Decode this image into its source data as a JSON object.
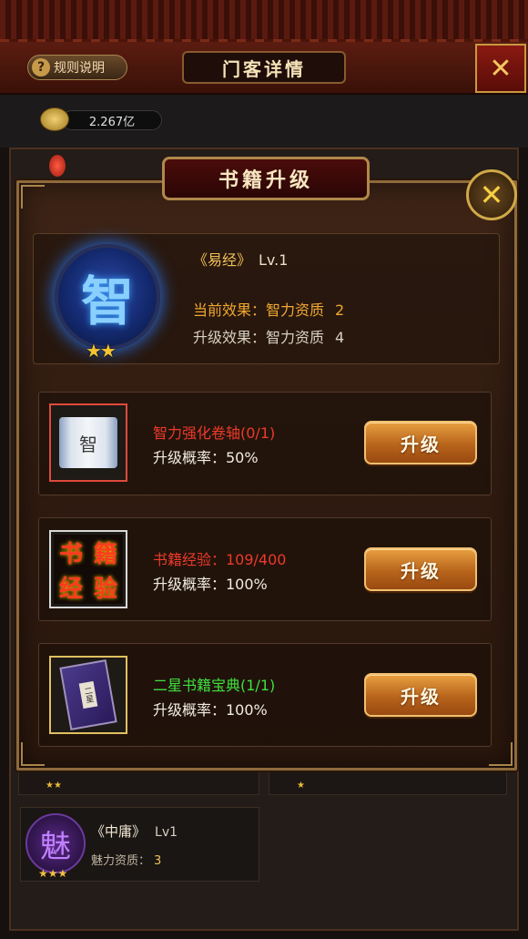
{
  "header": {
    "rules_label": "规则说明",
    "page_title": "门客详情",
    "close_symbol": "✕"
  },
  "currency": {
    "amount": "2.267亿"
  },
  "modal": {
    "title": "书籍升级",
    "close_symbol": "✕",
    "book": {
      "name": "《易经》",
      "level": "Lv.1",
      "emblem_char": "智",
      "stars": "★★",
      "current_effect_label": "当前效果：智力资质",
      "current_effect_value": "2",
      "upgrade_effect_label": "升级效果：智力资质",
      "upgrade_effect_value": "4"
    },
    "options": [
      {
        "name": "智力强化卷轴(0/1)",
        "rate": "升级概率：50%",
        "button": "升级",
        "icon_char": "智",
        "name_color": "#ec3a2a"
      },
      {
        "name": "书籍经验：109/400",
        "rate": "升级概率：100%",
        "button": "升级",
        "icon_chars": [
          "书",
          "籍",
          "经",
          "验"
        ],
        "name_color": "#ec3a2a"
      },
      {
        "name": "二星书籍宝典(1/1)",
        "rate": "升级概率：100%",
        "button": "升级",
        "icon_char": "二星",
        "name_color": "#40e040"
      }
    ]
  },
  "background_cards": {
    "book": {
      "name": "《中庸》",
      "level": "Lv1",
      "attr_label": "魅力资质：",
      "attr_value": "3",
      "emblem_char": "魅",
      "stars": "★★★"
    },
    "partial_stars_left": "★★",
    "partial_stars_right": "★"
  }
}
